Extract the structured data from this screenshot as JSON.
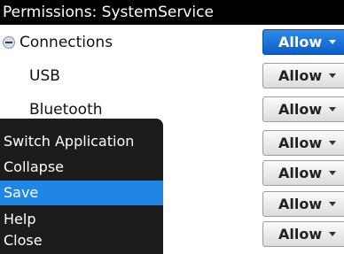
{
  "title": "Permissions: SystemService",
  "permissions": [
    {
      "label": "Connections",
      "value": "Allow",
      "type": "group",
      "expanded": true
    },
    {
      "label": "USB",
      "value": "Allow"
    },
    {
      "label": "Bluetooth",
      "value": "Allow"
    },
    {
      "label": "",
      "value": "Allow"
    },
    {
      "label": "",
      "value": "Allow"
    },
    {
      "label": "",
      "value": "Allow"
    },
    {
      "label": "",
      "value": "Allow"
    }
  ],
  "menu": {
    "items": [
      "Switch Application",
      "Collapse",
      "Save",
      "Help",
      "Close"
    ],
    "selected": "Save"
  },
  "colors": {
    "accent": "#1f86e6",
    "title_bar": "#000000",
    "menu_bg": "#1c1c1c"
  }
}
